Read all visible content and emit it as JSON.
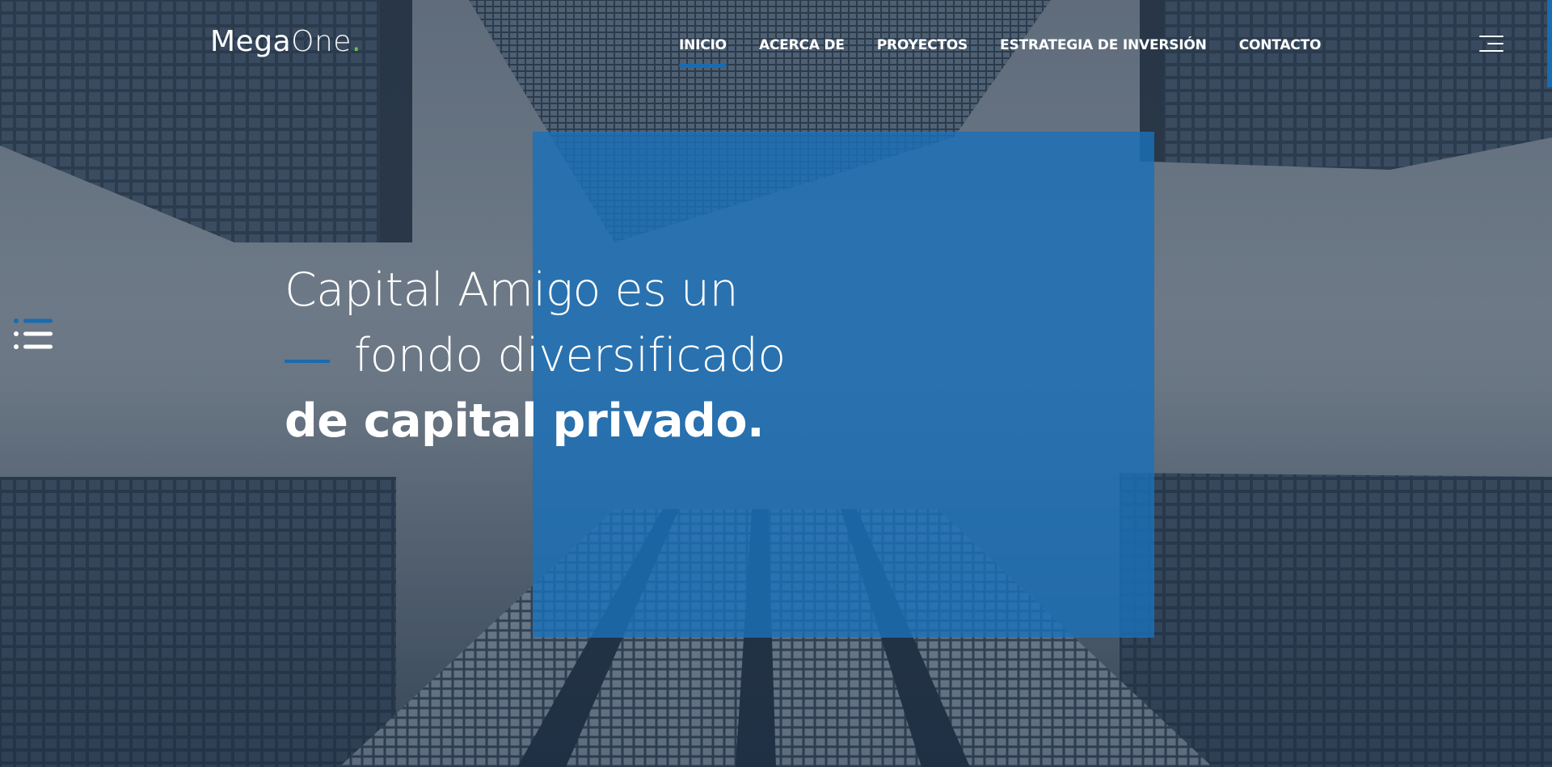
{
  "brand": {
    "logo_main": "Mega",
    "logo_light": "One",
    "logo_dot": ".",
    "dot_color": "#6cc24a"
  },
  "nav": {
    "items": [
      {
        "label": "INICIO",
        "active": true
      },
      {
        "label": "ACERCA DE",
        "active": false
      },
      {
        "label": "PROYECTOS",
        "active": false
      },
      {
        "label": "ESTRATEGIA DE INVERSIÓN",
        "active": false
      },
      {
        "label": "CONTACTO",
        "active": false
      }
    ],
    "menu_icon": "hamburger-menu-icon"
  },
  "hero": {
    "line1": "Capital Amigo es un",
    "line2": "fondo diversificado",
    "line3": "de capital privado."
  },
  "side": {
    "icon": "list-icon"
  },
  "colors": {
    "accent": "#1a6bb0",
    "overlay_box": "#1b70b8",
    "text": "#ffffff"
  }
}
